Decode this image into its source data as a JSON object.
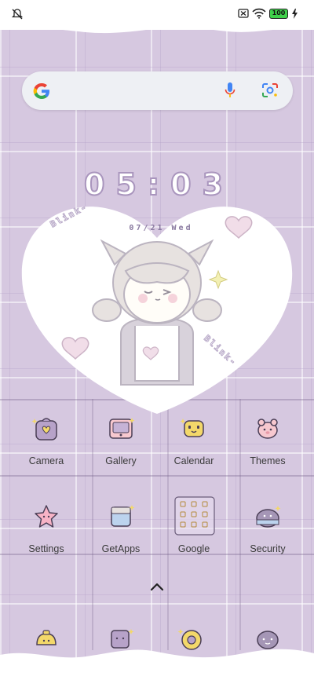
{
  "status_bar": {
    "battery_level": "100",
    "icons": [
      "notification-off-icon",
      "sim-off-icon",
      "wifi-icon",
      "battery-icon",
      "charging-icon"
    ]
  },
  "search_bar": {
    "icons": [
      "google-logo",
      "mic-icon",
      "lens-camera-icon"
    ]
  },
  "clock_widget": {
    "time": "05:03",
    "date": "07/21 Wed",
    "decor_text_left": "Blink-",
    "decor_text_right": "Blink-"
  },
  "apps": [
    {
      "label": "Camera",
      "icon": "camera-icon"
    },
    {
      "label": "Gallery",
      "icon": "gallery-icon"
    },
    {
      "label": "Calendar",
      "icon": "calendar-icon"
    },
    {
      "label": "Themes",
      "icon": "themes-icon"
    },
    {
      "label": "Settings",
      "icon": "settings-icon"
    },
    {
      "label": "GetApps",
      "icon": "getapps-icon"
    },
    {
      "label": "Google",
      "icon": "google-folder-icon"
    },
    {
      "label": "Security",
      "icon": "security-icon"
    }
  ],
  "dock": [
    {
      "icon": "phone-icon"
    },
    {
      "icon": "messages-icon"
    },
    {
      "icon": "chrome-icon"
    },
    {
      "icon": "music-icon"
    }
  ],
  "colors": {
    "wallpaper": "#d6c8e0",
    "clock_outline": "#a995bd",
    "battery_fill": "#3fd14a"
  }
}
